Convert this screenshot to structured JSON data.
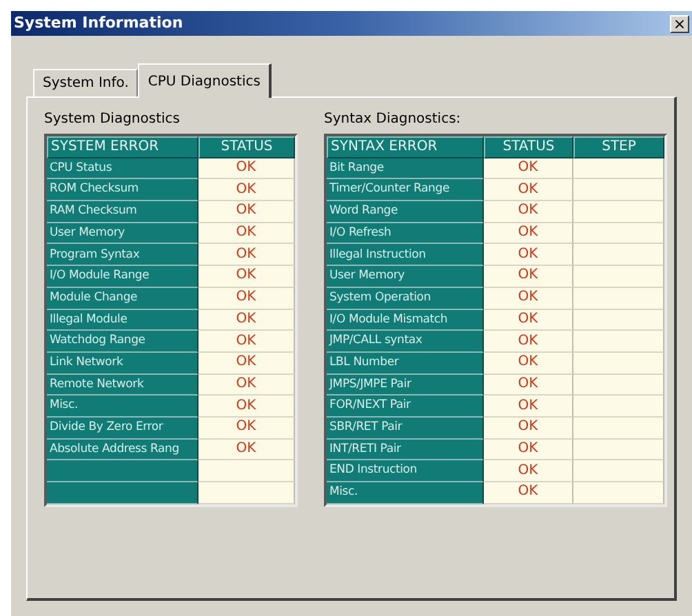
{
  "window": {
    "title": "System Information",
    "close": "×"
  },
  "tabs": [
    {
      "label": "System Info.",
      "selected": false
    },
    {
      "label": "CPU Diagnostics",
      "selected": true
    }
  ],
  "system": {
    "title": "System Diagnostics",
    "columns": [
      "SYSTEM ERROR",
      "STATUS"
    ],
    "rows": [
      {
        "name": "CPU Status",
        "status": "OK"
      },
      {
        "name": "ROM Checksum",
        "status": "OK"
      },
      {
        "name": "RAM Checksum",
        "status": "OK"
      },
      {
        "name": "User Memory",
        "status": "OK"
      },
      {
        "name": "Program Syntax",
        "status": "OK"
      },
      {
        "name": "I/O Module Range",
        "status": "OK"
      },
      {
        "name": "Module Change",
        "status": "OK"
      },
      {
        "name": "Illegal Module",
        "status": "OK"
      },
      {
        "name": "Watchdog Range",
        "status": "OK"
      },
      {
        "name": "Link Network",
        "status": "OK"
      },
      {
        "name": "Remote Network",
        "status": "OK"
      },
      {
        "name": "Misc.",
        "status": "OK"
      },
      {
        "name": "Divide By Zero Error",
        "status": "OK"
      },
      {
        "name": "Absolute Address Rang",
        "status": "OK"
      },
      {},
      {}
    ]
  },
  "syntax": {
    "title": "Syntax Diagnostics:",
    "columns": [
      "SYNTAX ERROR",
      "STATUS",
      "STEP"
    ],
    "rows": [
      {
        "name": "Bit Range",
        "status": "OK"
      },
      {
        "name": "Timer/Counter Range",
        "status": "OK"
      },
      {
        "name": "Word Range",
        "status": "OK"
      },
      {
        "name": "I/O Refresh",
        "status": "OK"
      },
      {
        "name": "Illegal Instruction",
        "status": "OK"
      },
      {
        "name": "User Memory",
        "status": "OK"
      },
      {
        "name": "System Operation",
        "status": "OK"
      },
      {
        "name": "I/O Module Mismatch",
        "status": "OK"
      },
      {
        "name": "JMP/CALL syntax",
        "status": "OK"
      },
      {
        "name": "LBL Number",
        "status": "OK"
      },
      {
        "name": "JMPS/JMPE Pair",
        "status": "OK"
      },
      {
        "name": "FOR/NEXT Pair",
        "status": "OK"
      },
      {
        "name": "SBR/RET Pair",
        "status": "OK"
      },
      {
        "name": "INT/RETI Pair",
        "status": "OK"
      },
      {
        "name": "END Instruction",
        "status": "OK"
      },
      {
        "name": "Misc.",
        "status": "OK"
      }
    ]
  }
}
